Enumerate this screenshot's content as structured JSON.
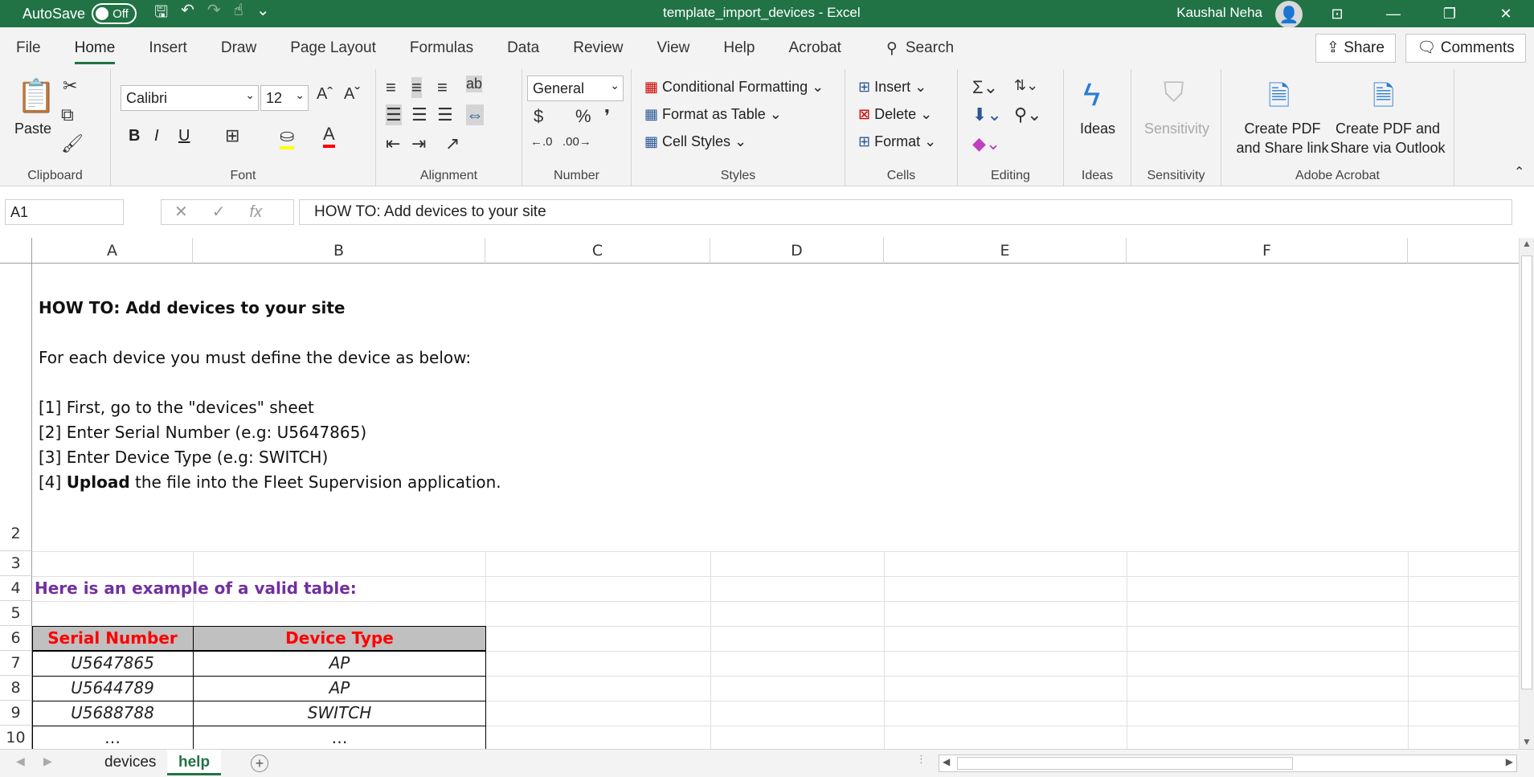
{
  "titlebar": {
    "autosave_label": "AutoSave",
    "autosave_state": "Off",
    "window_title": "template_import_devices  -  Excel",
    "user_name": "Kaushal Neha"
  },
  "menu": {
    "items": [
      "File",
      "Home",
      "Insert",
      "Draw",
      "Page Layout",
      "Formulas",
      "Data",
      "Review",
      "View",
      "Help",
      "Acrobat"
    ],
    "search": "Search",
    "share": "Share",
    "comments": "Comments"
  },
  "ribbon": {
    "clipboard": {
      "label": "Clipboard",
      "paste": "Paste"
    },
    "font": {
      "label": "Font",
      "name": "Calibri",
      "size": "12",
      "bold": "B",
      "italic": "I",
      "underline": "U"
    },
    "alignment": {
      "label": "Alignment"
    },
    "number": {
      "label": "Number",
      "format": "General"
    },
    "styles": {
      "label": "Styles",
      "conditional": "Conditional Formatting",
      "format_table": "Format as Table",
      "cell_styles": "Cell Styles"
    },
    "cells": {
      "label": "Cells",
      "insert": "Insert",
      "delete": "Delete",
      "format": "Format"
    },
    "editing": {
      "label": "Editing"
    },
    "ideas": {
      "label": "Ideas",
      "button": "Ideas"
    },
    "sensitivity": {
      "label": "Sensitivity",
      "button": "Sensitivity"
    },
    "acrobat": {
      "label": "Adobe Acrobat",
      "create_pdf_link_1": "Create PDF",
      "create_pdf_link_2": "and Share link",
      "create_pdf_outlook_1": "Create PDF and",
      "create_pdf_outlook_2": "Share via Outlook"
    }
  },
  "formula_bar": {
    "name_box": "A1",
    "formula": "HOW TO: Add devices to your site"
  },
  "sheet": {
    "columns": [
      "A",
      "B",
      "C",
      "D",
      "E",
      "F"
    ],
    "rows": [
      "2",
      "3",
      "4",
      "5",
      "6",
      "7",
      "8",
      "9",
      "10"
    ],
    "howto_title": "HOW TO: Add devices to your site",
    "howto_intro": "For each device you must define the device as below:",
    "step1": "[1] First, go to the \"devices\" sheet",
    "step2": "[2] Enter Serial Number (e.g: U5647865)",
    "step3": "[3] Enter Device Type (e.g: SWITCH)",
    "step4_prefix": "[4] ",
    "step4_bold": "Upload",
    "step4_rest": " the file into the Fleet Supervision application.",
    "example_heading": "Here is an example of a valid table:",
    "table_headers": [
      "Serial Number",
      "Device Type"
    ],
    "table_rows": [
      [
        "U5647865",
        "AP"
      ],
      [
        "U5644789",
        "AP"
      ],
      [
        "U5688788",
        "SWITCH"
      ],
      [
        "…",
        "…"
      ]
    ]
  },
  "tabs": [
    "devices",
    "help"
  ],
  "colors": {
    "excel_green": "#217346",
    "purple": "#7030a0",
    "red": "#ff0000"
  }
}
